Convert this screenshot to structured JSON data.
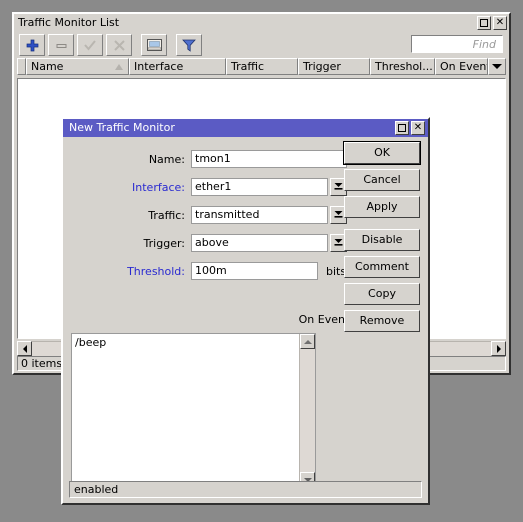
{
  "window": {
    "title": "Traffic Monitor List",
    "buttons": {
      "restore": "restore-icon",
      "close": "close-icon"
    },
    "toolbar": {
      "add": "+",
      "remove": "−",
      "enable": "check-icon",
      "disable": "cross-icon",
      "comment": "comment-icon",
      "filter": "filter-icon"
    },
    "find": {
      "placeholder": "Find",
      "value": ""
    },
    "columns": [
      {
        "label": "Name",
        "sorted": "asc"
      },
      {
        "label": "Interface"
      },
      {
        "label": "Traffic"
      },
      {
        "label": "Trigger"
      },
      {
        "label": "Threshol..."
      },
      {
        "label": "On Event"
      }
    ],
    "rows": [],
    "status": "0 items"
  },
  "dialog": {
    "title": "New Traffic Monitor",
    "buttons": {
      "restore": "restore-icon",
      "close": "close-icon"
    },
    "fields": {
      "name": {
        "label": "Name:",
        "value": "tmon1",
        "highlight": false
      },
      "interface": {
        "label": "Interface:",
        "value": "ether1",
        "highlight": true
      },
      "traffic": {
        "label": "Traffic:",
        "value": "transmitted",
        "highlight": false
      },
      "trigger": {
        "label": "Trigger:",
        "value": "above",
        "highlight": false
      },
      "threshold": {
        "label": "Threshold:",
        "value": "100m",
        "unit": "bits/s",
        "highlight": true
      }
    },
    "on_event": {
      "label": "On Event:",
      "value": "/beep"
    },
    "actions": [
      {
        "label": "OK",
        "default": true
      },
      {
        "label": "Cancel",
        "default": false
      },
      {
        "label": "Apply",
        "default": false
      },
      {
        "label": "Disable",
        "default": false
      },
      {
        "label": "Comment",
        "default": false
      },
      {
        "label": "Copy",
        "default": false
      },
      {
        "label": "Remove",
        "default": false
      }
    ],
    "status": "enabled"
  },
  "colors": {
    "dialog_titlebar": "#5b5bc4",
    "face": "#d6d3ce",
    "desktop": "#8a8a8a",
    "label_highlight": "#2a2ad0",
    "add_icon": "#2d4fc4"
  }
}
